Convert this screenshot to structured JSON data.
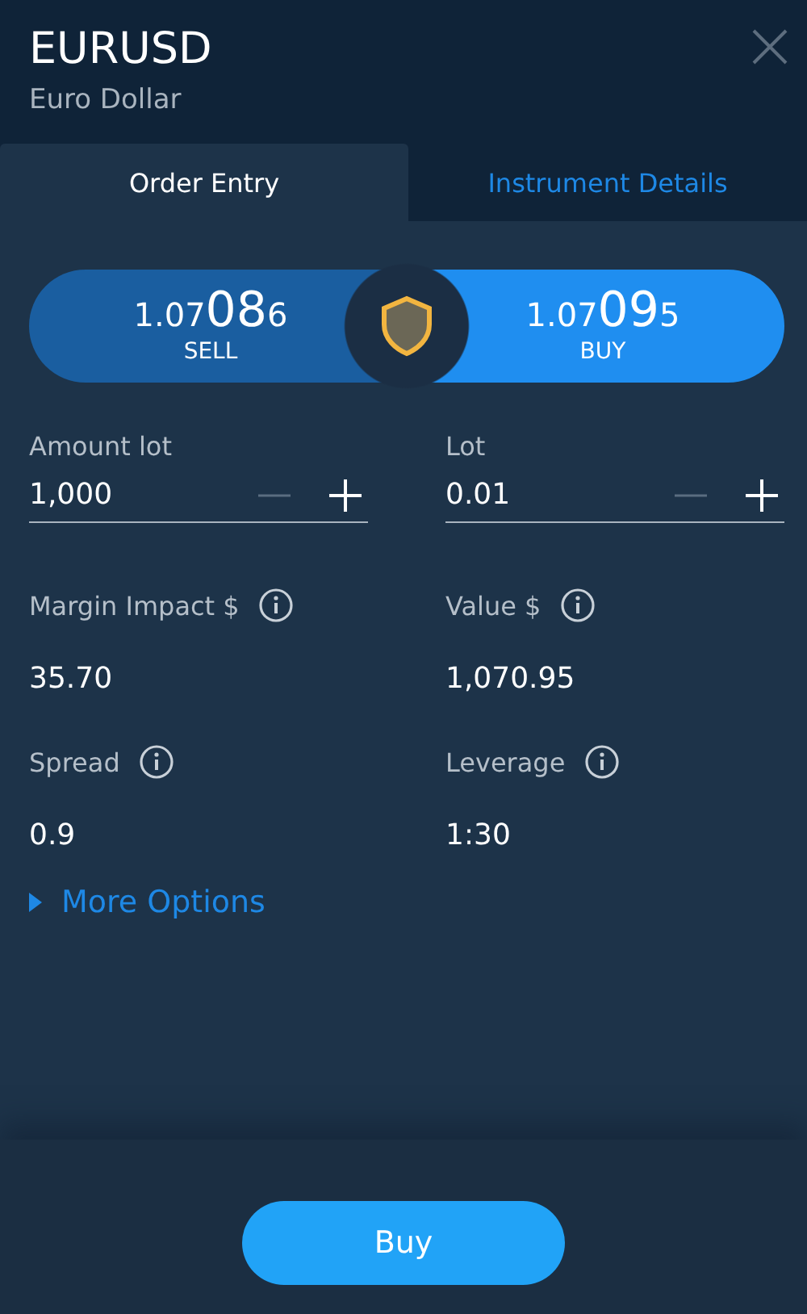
{
  "header": {
    "symbol": "EURUSD",
    "name": "Euro Dollar"
  },
  "tabs": [
    {
      "label": "Order Entry",
      "selected": true
    },
    {
      "label": "Instrument Details",
      "selected": false
    }
  ],
  "quotes": [
    {
      "prefix": "1.07",
      "pips": "08",
      "fraction": "6",
      "side": "SELL",
      "selected": false
    },
    {
      "prefix": "1.07",
      "pips": "09",
      "fraction": "5",
      "side": "BUY",
      "selected": true
    }
  ],
  "inputs": [
    {
      "label": "Amount lot",
      "value": "1,000"
    },
    {
      "label": "Lot",
      "value": "0.01"
    }
  ],
  "stats": [
    {
      "label": "Margin Impact $",
      "value": "35.70"
    },
    {
      "label": "Value $",
      "value": "1,070.95"
    },
    {
      "label": "Spread",
      "value": "0.9"
    },
    {
      "label": "Leverage",
      "value": "1:30"
    }
  ],
  "more_options": {
    "label": "More Options",
    "expanded": false
  },
  "action_button": "Buy"
}
